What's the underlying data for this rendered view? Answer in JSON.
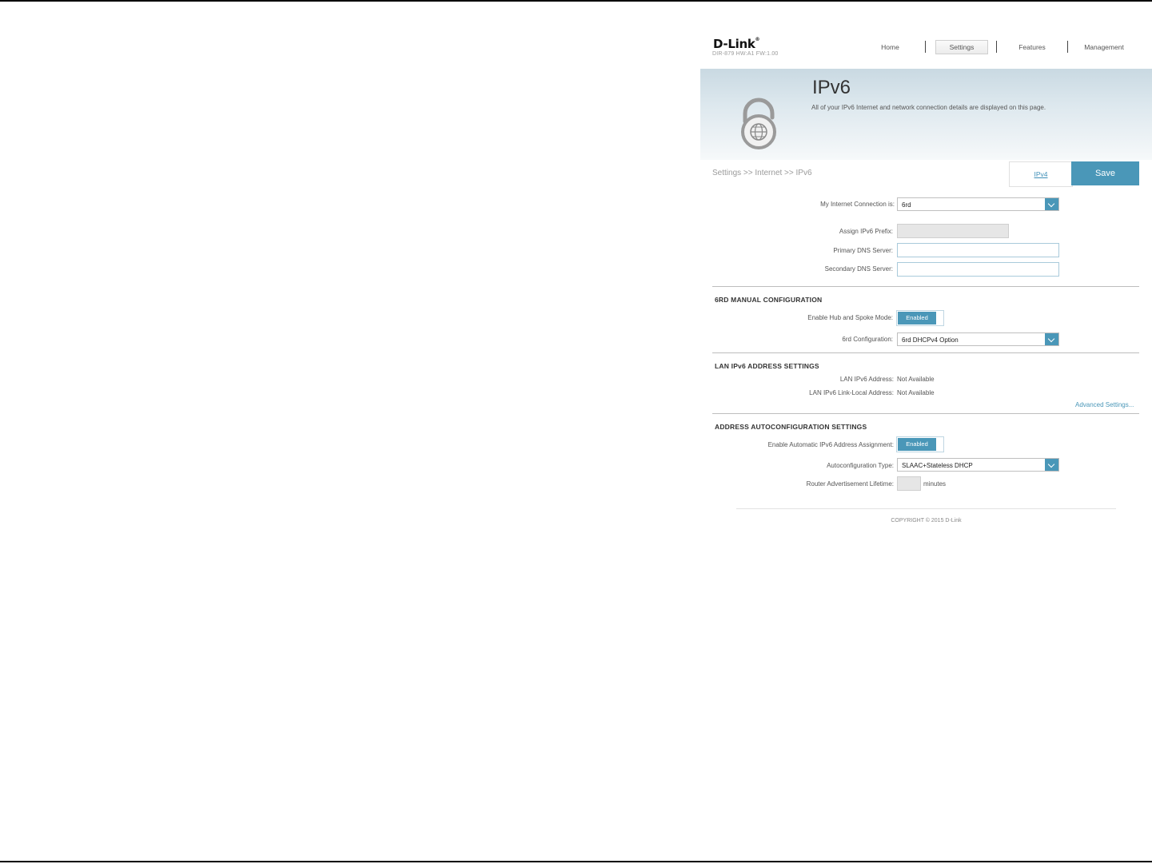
{
  "header": {
    "brand": "D-Link",
    "model": "DIR-879 HW:A1 FW:1.00",
    "nav": [
      {
        "label": "Home",
        "active": false
      },
      {
        "label": "Settings",
        "active": true
      },
      {
        "label": "Features",
        "active": false
      },
      {
        "label": "Management",
        "active": false
      }
    ]
  },
  "banner": {
    "title": "IPv6",
    "description": "All of your IPv6 Internet and network connection details are displayed on this page.",
    "icon": "ipv6-lock-globe-icon"
  },
  "toolbar": {
    "breadcrumb": "Settings >> Internet >> IPv6",
    "ipv4_label": "IPv4",
    "save_label": "Save"
  },
  "connection": {
    "my_connection_label": "My Internet Connection is:",
    "my_connection_value": "6rd",
    "assign_prefix_label": "Assign IPv6 Prefix:",
    "assign_prefix_value": "",
    "primary_dns_label": "Primary DNS Server:",
    "primary_dns_value": "",
    "secondary_dns_label": "Secondary DNS Server:",
    "secondary_dns_value": ""
  },
  "manual_6rd": {
    "title": "6RD MANUAL CONFIGURATION",
    "hub_spoke_label": "Enable Hub and Spoke Mode:",
    "hub_spoke_value": "Enabled",
    "config_label": "6rd Configuration:",
    "config_value": "6rd DHCPv4 Option"
  },
  "lan": {
    "title": "LAN IPv6 ADDRESS SETTINGS",
    "address_label": "LAN IPv6 Address:",
    "address_value": "Not Available",
    "link_local_label": "LAN IPv6 Link-Local Address:",
    "link_local_value": "Not Available",
    "advanced_label": "Advanced Settings..."
  },
  "autoconfig": {
    "title": "ADDRESS AUTOCONFIGURATION SETTINGS",
    "auto_assign_label": "Enable Automatic IPv6 Address Assignment:",
    "auto_assign_value": "Enabled",
    "type_label": "Autoconfiguration Type:",
    "type_value": "SLAAC+Stateless DHCP",
    "lifetime_label": "Router Advertisement Lifetime:",
    "lifetime_value": "",
    "lifetime_unit": "minutes"
  },
  "footer": {
    "copyright": "COPYRIGHT © 2015 D-Link"
  },
  "colors": {
    "accent": "#4a97b8",
    "link": "#3f8fb7"
  }
}
